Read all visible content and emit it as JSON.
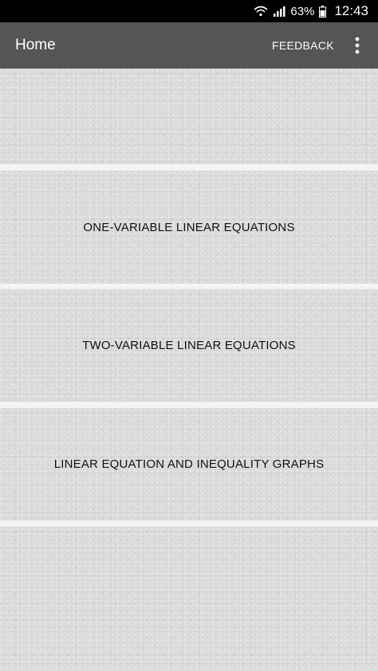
{
  "status_bar": {
    "battery_percent": "63%",
    "time": "12:43",
    "icons": [
      "wifi-icon",
      "signal-icon",
      "battery-icon"
    ]
  },
  "app_bar": {
    "title": "Home",
    "feedback_label": "FEEDBACK",
    "overflow_icon": "more-vert-icon"
  },
  "cards": [
    {
      "label": ""
    },
    {
      "label": "ONE-VARIABLE LINEAR EQUATIONS"
    },
    {
      "label": "TWO-VARIABLE LINEAR EQUATIONS"
    },
    {
      "label": "LINEAR EQUATION AND INEQUALITY GRAPHS"
    },
    {
      "label": ""
    }
  ],
  "colors": {
    "app_bar": "#555555",
    "status_bar": "#000000",
    "card": "#d9d9d9",
    "divider": "#f4f4f4"
  }
}
